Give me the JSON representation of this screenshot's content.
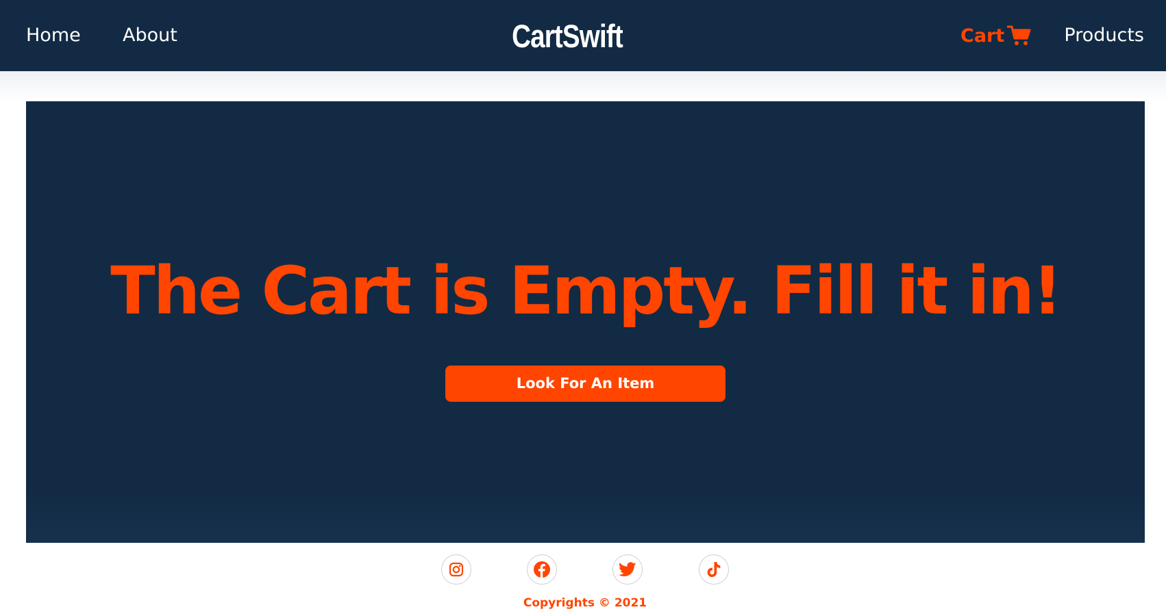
{
  "colors": {
    "navy": "#122a44",
    "accent": "#ff4500",
    "white": "#ffffff"
  },
  "nav": {
    "home": "Home",
    "about": "About",
    "brand": "CartSwift",
    "cart": "Cart",
    "cart_icon": "shopping-cart-icon",
    "products": "Products"
  },
  "hero": {
    "title": "The Cart is Empty. Fill it in!",
    "button": "Look For An Item"
  },
  "footer": {
    "socials": [
      {
        "name": "instagram",
        "icon": "instagram-icon"
      },
      {
        "name": "facebook",
        "icon": "facebook-icon"
      },
      {
        "name": "twitter",
        "icon": "twitter-icon"
      },
      {
        "name": "tiktok",
        "icon": "tiktok-icon"
      }
    ],
    "copyright": "Copyrights © 2021"
  }
}
